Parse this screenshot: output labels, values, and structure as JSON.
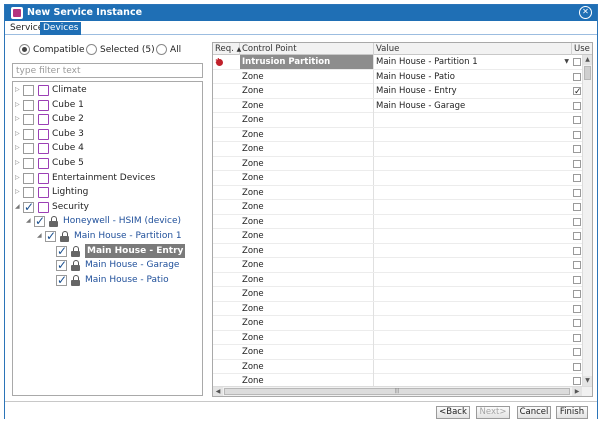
{
  "window": {
    "title": "New Service Instance"
  },
  "tabs": [
    {
      "label": "Service",
      "active": false
    },
    {
      "label": "Devices",
      "active": true
    }
  ],
  "filter_mode": {
    "options": [
      {
        "label": "Compatible",
        "selected": true
      },
      {
        "label": "Selected (5)",
        "selected": false
      },
      {
        "label": "All",
        "selected": false
      }
    ]
  },
  "filter": {
    "placeholder": "type filter text",
    "value": ""
  },
  "tree": [
    {
      "label": "Climate",
      "level": 0,
      "expanded": false,
      "checked": false,
      "icon": "folder-icon"
    },
    {
      "label": "Cube 1",
      "level": 0,
      "expanded": false,
      "checked": false,
      "icon": "folder-icon"
    },
    {
      "label": "Cube 2",
      "level": 0,
      "expanded": false,
      "checked": false,
      "icon": "folder-icon"
    },
    {
      "label": "Cube 3",
      "level": 0,
      "expanded": false,
      "checked": false,
      "icon": "folder-icon"
    },
    {
      "label": "Cube 4",
      "level": 0,
      "expanded": false,
      "checked": false,
      "icon": "folder-icon"
    },
    {
      "label": "Cube 5",
      "level": 0,
      "expanded": false,
      "checked": false,
      "icon": "folder-icon"
    },
    {
      "label": "Entertainment Devices",
      "level": 0,
      "expanded": false,
      "checked": false,
      "icon": "folder-icon"
    },
    {
      "label": "Lighting",
      "level": 0,
      "expanded": false,
      "checked": false,
      "icon": "folder-icon"
    },
    {
      "label": "Security",
      "level": 0,
      "expanded": true,
      "checked": true,
      "icon": "folder-icon"
    },
    {
      "label": "Honeywell - HSIM (device)",
      "level": 1,
      "expanded": true,
      "checked": true,
      "icon": "lock-icon"
    },
    {
      "label": "Main House - Partition 1",
      "level": 2,
      "expanded": true,
      "checked": true,
      "icon": "lock-icon"
    },
    {
      "label": "Main House - Entry",
      "level": 3,
      "checked": true,
      "icon": "lock-icon",
      "selected": true
    },
    {
      "label": "Main House - Garage",
      "level": 3,
      "checked": true,
      "icon": "lock-icon"
    },
    {
      "label": "Main House - Patio",
      "level": 3,
      "checked": true,
      "icon": "lock-icon"
    }
  ],
  "grid": {
    "columns": {
      "req": "Req.",
      "control_point": "Control Point",
      "value": "Value",
      "use": "Use"
    },
    "rows": [
      {
        "control_point": "Intrusion Partition",
        "value": "Main House - Partition 1",
        "required": true,
        "use": false,
        "highlight": true
      },
      {
        "control_point": "Zone",
        "value": "Main House - Patio",
        "use": false
      },
      {
        "control_point": "Zone",
        "value": "Main House - Entry",
        "use": true
      },
      {
        "control_point": "Zone",
        "value": "Main House - Garage",
        "use": false
      },
      {
        "control_point": "Zone",
        "value": "",
        "use": false
      },
      {
        "control_point": "Zone",
        "value": "",
        "use": false
      },
      {
        "control_point": "Zone",
        "value": "",
        "use": false
      },
      {
        "control_point": "Zone",
        "value": "",
        "use": false
      },
      {
        "control_point": "Zone",
        "value": "",
        "use": false
      },
      {
        "control_point": "Zone",
        "value": "",
        "use": false
      },
      {
        "control_point": "Zone",
        "value": "",
        "use": false
      },
      {
        "control_point": "Zone",
        "value": "",
        "use": false
      },
      {
        "control_point": "Zone",
        "value": "",
        "use": false
      },
      {
        "control_point": "Zone",
        "value": "",
        "use": false
      },
      {
        "control_point": "Zone",
        "value": "",
        "use": false
      },
      {
        "control_point": "Zone",
        "value": "",
        "use": false
      },
      {
        "control_point": "Zone",
        "value": "",
        "use": false
      },
      {
        "control_point": "Zone",
        "value": "",
        "use": false
      },
      {
        "control_point": "Zone",
        "value": "",
        "use": false
      },
      {
        "control_point": "Zone",
        "value": "",
        "use": false
      },
      {
        "control_point": "Zone",
        "value": "",
        "use": false
      },
      {
        "control_point": "Zone",
        "value": "",
        "use": false
      },
      {
        "control_point": "Zone",
        "value": "",
        "use": false
      }
    ]
  },
  "footer": {
    "back": "<Back",
    "next": "Next>",
    "cancel": "Cancel",
    "finish": "Finish"
  }
}
